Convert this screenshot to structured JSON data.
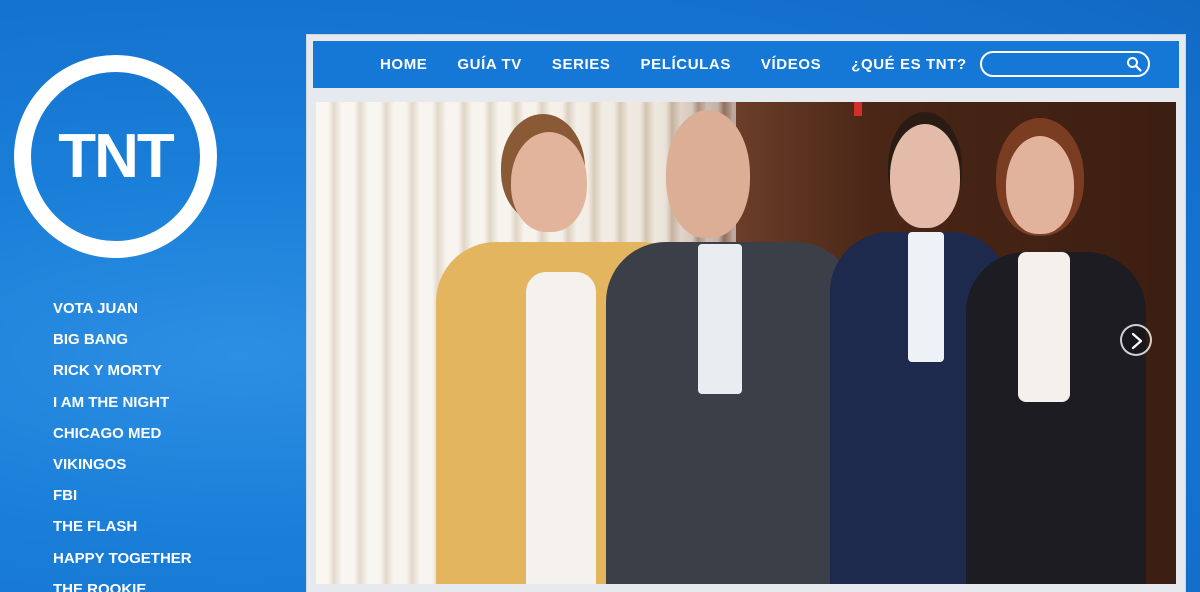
{
  "brand": {
    "logo_text": "TNT",
    "accent": "#1578d6",
    "background": "#1a7fd9"
  },
  "sidebar": {
    "items": [
      {
        "label": "VOTA JUAN"
      },
      {
        "label": "BIG BANG"
      },
      {
        "label": "RICK Y MORTY"
      },
      {
        "label": "I AM THE NIGHT"
      },
      {
        "label": "CHICAGO MED"
      },
      {
        "label": "VIKINGOS"
      },
      {
        "label": "FBI"
      },
      {
        "label": "THE FLASH"
      },
      {
        "label": "HAPPY TOGETHER"
      },
      {
        "label": "THE ROOKIE"
      }
    ]
  },
  "topnav": {
    "items": [
      {
        "label": "HOME"
      },
      {
        "label": "GUÍA TV"
      },
      {
        "label": "SERIES"
      },
      {
        "label": "PELÍCULAS"
      },
      {
        "label": "VÍDEOS"
      },
      {
        "label": "¿QUÉ ES TNT?"
      }
    ],
    "search": {
      "value": "",
      "placeholder": "",
      "icon": "search-icon"
    }
  },
  "hero": {
    "next_icon": "chevron-right-icon"
  }
}
